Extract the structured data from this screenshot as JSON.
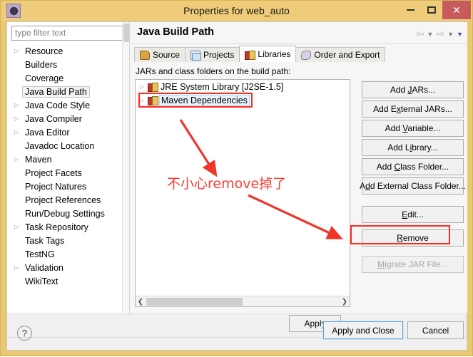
{
  "window": {
    "title": "Properties for web_auto",
    "icon": "app-properties-icon",
    "minimize_label": "–",
    "maximize_label": "□",
    "close_label": "✕"
  },
  "sidebar": {
    "filter": {
      "placeholder": "type filter text",
      "value": ""
    },
    "items": [
      {
        "label": "Resource",
        "expandable": true,
        "selected": false
      },
      {
        "label": "Builders",
        "expandable": false,
        "selected": false
      },
      {
        "label": "Coverage",
        "expandable": false,
        "selected": false
      },
      {
        "label": "Java Build Path",
        "expandable": false,
        "selected": true
      },
      {
        "label": "Java Code Style",
        "expandable": true,
        "selected": false
      },
      {
        "label": "Java Compiler",
        "expandable": true,
        "selected": false
      },
      {
        "label": "Java Editor",
        "expandable": true,
        "selected": false
      },
      {
        "label": "Javadoc Location",
        "expandable": false,
        "selected": false
      },
      {
        "label": "Maven",
        "expandable": true,
        "selected": false
      },
      {
        "label": "Project Facets",
        "expandable": false,
        "selected": false
      },
      {
        "label": "Project Natures",
        "expandable": false,
        "selected": false
      },
      {
        "label": "Project References",
        "expandable": false,
        "selected": false
      },
      {
        "label": "Run/Debug Settings",
        "expandable": false,
        "selected": false
      },
      {
        "label": "Task Repository",
        "expandable": true,
        "selected": false
      },
      {
        "label": "Task Tags",
        "expandable": false,
        "selected": false
      },
      {
        "label": "TestNG",
        "expandable": false,
        "selected": false
      },
      {
        "label": "Validation",
        "expandable": true,
        "selected": false
      },
      {
        "label": "WikiText",
        "expandable": false,
        "selected": false
      }
    ]
  },
  "page": {
    "title": "Java Build Path",
    "nav": {
      "back_icon": "arrow-left-icon",
      "back_menu_icon": "chevron-down-icon",
      "forward_icon": "arrow-right-icon",
      "forward_menu_icon": "chevron-down-icon",
      "view_menu_icon": "chevron-down-icon"
    },
    "tabs": [
      {
        "label": "Source",
        "icon": "source-folder-icon",
        "active": false
      },
      {
        "label": "Projects",
        "icon": "projects-folder-icon",
        "active": false
      },
      {
        "label": "Libraries",
        "icon": "libraries-books-icon",
        "active": true
      },
      {
        "label": "Order and Export",
        "icon": "order-export-icon",
        "active": false
      }
    ],
    "list_label": "JARs and class folders on the build path:",
    "entries": [
      {
        "label": "JRE System Library [J2SE-1.5]",
        "icon": "library-icon",
        "expandable": true,
        "selected": false
      },
      {
        "label": "Maven Dependencies",
        "icon": "library-icon",
        "expandable": true,
        "selected": true
      }
    ],
    "hscroll": {
      "left_icon": "chevron-left-icon",
      "right_icon": "chevron-right-icon"
    },
    "buttons": [
      {
        "label": "Add JARs...",
        "mnemonic": "J",
        "enabled": true
      },
      {
        "label": "Add External JARs...",
        "mnemonic": "x",
        "enabled": true
      },
      {
        "label": "Add Variable...",
        "mnemonic": "V",
        "enabled": true
      },
      {
        "label": "Add Library...",
        "mnemonic": "i",
        "enabled": true
      },
      {
        "label": "Add Class Folder...",
        "mnemonic": "C",
        "enabled": true
      },
      {
        "label": "Add External Class Folder...",
        "mnemonic": "d",
        "enabled": true
      },
      {
        "label": "Edit...",
        "mnemonic": "E",
        "enabled": true
      },
      {
        "label": "Remove",
        "mnemonic": "R",
        "enabled": true
      },
      {
        "label": "Migrate JAR File...",
        "mnemonic": "M",
        "enabled": false
      }
    ],
    "apply_label": "Apply"
  },
  "footer": {
    "help_icon": "help-question-icon",
    "apply_and_close_label": "Apply and Close",
    "cancel_label": "Cancel"
  },
  "annotations": {
    "note_text": "不小心remove掉了",
    "color": "#ff3b30",
    "highlight_entry": "Maven Dependencies",
    "highlight_button": "Remove"
  }
}
